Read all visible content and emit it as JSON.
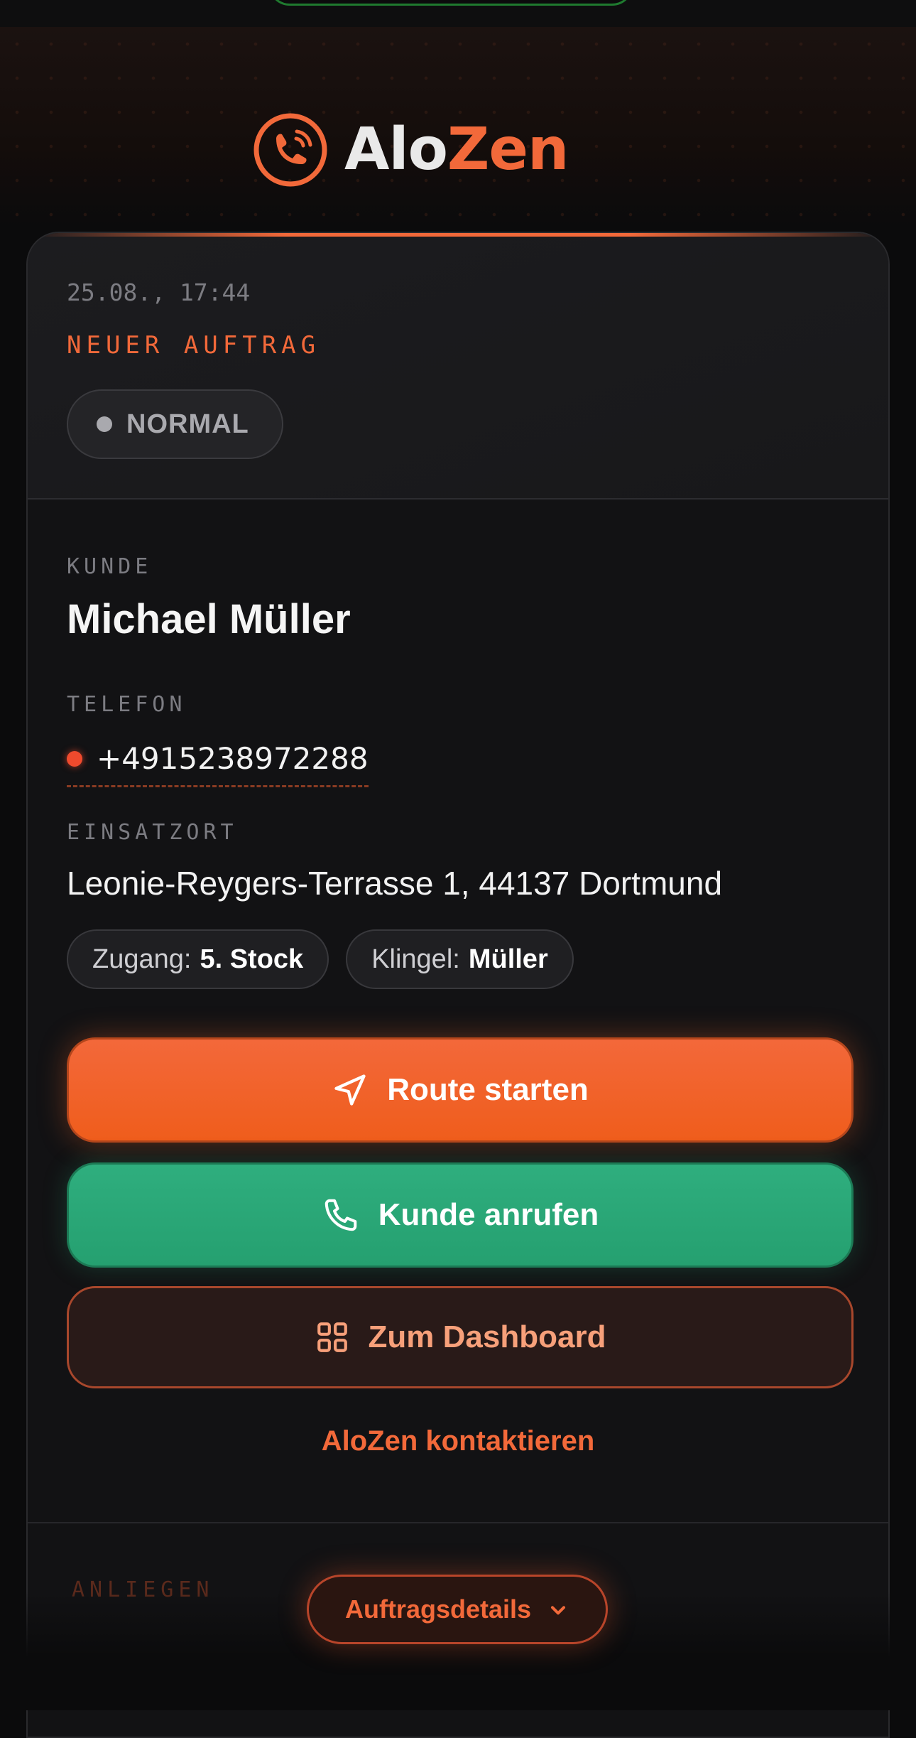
{
  "brand": {
    "name_part1": "Alo",
    "name_part2": "Zen"
  },
  "order": {
    "timestamp": "25.08., 17:44",
    "status": "NEUER AUFTRAG",
    "priority": "NORMAL"
  },
  "customer": {
    "label": "KUNDE",
    "name": "Michael Müller",
    "phone_label": "TELEFON",
    "phone": "+4915238972288",
    "location_label": "EINSATZORT",
    "address": "Leonie-Reygers-Terrasse 1, 44137 Dortmund",
    "chips": [
      {
        "key": "Zugang:",
        "value": "5. Stock"
      },
      {
        "key": "Klingel:",
        "value": "Müller"
      }
    ]
  },
  "actions": {
    "route": "Route starten",
    "call": "Kunde anrufen",
    "dashboard": "Zum Dashboard",
    "contact": "AloZen kontaktieren"
  },
  "details": {
    "section_label": "ANLIEGEN",
    "toggle_label": "Auftragsdetails"
  },
  "colors": {
    "accent": "#f2693a",
    "call": "#2fae7e",
    "background": "#0b0b0c"
  },
  "icons": {
    "logo": "phone-waves-icon",
    "route": "navigation-arrow-icon",
    "call": "phone-icon",
    "dashboard": "grid-icon",
    "details": "chevron-down-icon"
  }
}
